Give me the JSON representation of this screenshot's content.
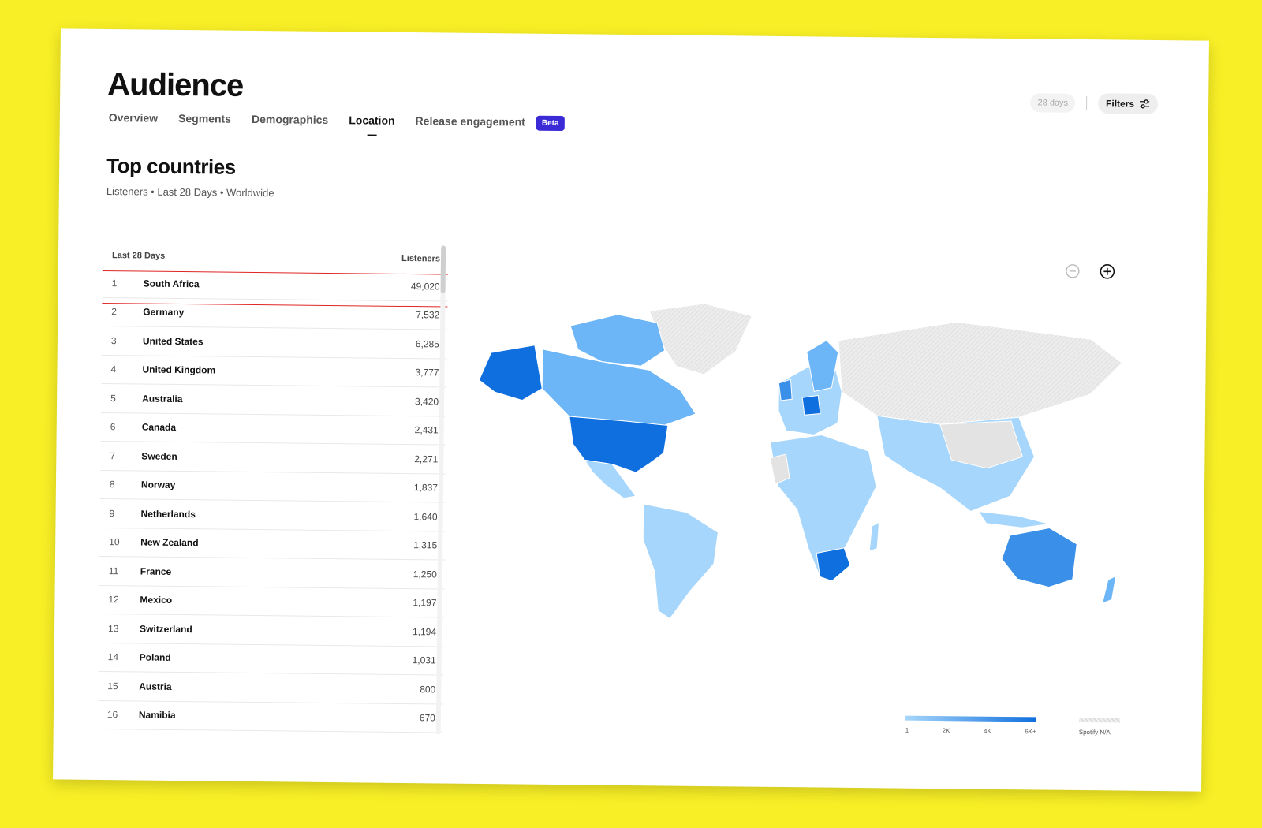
{
  "page": {
    "title": "Audience"
  },
  "tabs": [
    {
      "label": "Overview",
      "active": false
    },
    {
      "label": "Segments",
      "active": false
    },
    {
      "label": "Demographics",
      "active": false
    },
    {
      "label": "Location",
      "active": true
    },
    {
      "label": "Release engagement",
      "active": false
    }
  ],
  "badge": {
    "label": "Beta",
    "color": "#3b2bd6"
  },
  "controls": {
    "days_label": "28 days",
    "filters_label": "Filters",
    "filters_icon": "sliders-icon"
  },
  "section": {
    "title": "Top countries",
    "subtitle": "Listeners • Last 28 Days • Worldwide"
  },
  "table": {
    "header_left": "Last 28 Days",
    "header_right": "Listeners",
    "rows": [
      {
        "rank": "1",
        "country": "South Africa",
        "listeners": "49,020"
      },
      {
        "rank": "2",
        "country": "Germany",
        "listeners": "7,532"
      },
      {
        "rank": "3",
        "country": "United States",
        "listeners": "6,285"
      },
      {
        "rank": "4",
        "country": "United Kingdom",
        "listeners": "3,777"
      },
      {
        "rank": "5",
        "country": "Australia",
        "listeners": "3,420"
      },
      {
        "rank": "6",
        "country": "Canada",
        "listeners": "2,431"
      },
      {
        "rank": "7",
        "country": "Sweden",
        "listeners": "2,271"
      },
      {
        "rank": "8",
        "country": "Norway",
        "listeners": "1,837"
      },
      {
        "rank": "9",
        "country": "Netherlands",
        "listeners": "1,640"
      },
      {
        "rank": "10",
        "country": "New Zealand",
        "listeners": "1,315"
      },
      {
        "rank": "11",
        "country": "France",
        "listeners": "1,250"
      },
      {
        "rank": "12",
        "country": "Mexico",
        "listeners": "1,197"
      },
      {
        "rank": "13",
        "country": "Switzerland",
        "listeners": "1,194"
      },
      {
        "rank": "14",
        "country": "Poland",
        "listeners": "1,031"
      },
      {
        "rank": "15",
        "country": "Austria",
        "listeners": "800"
      },
      {
        "rank": "16",
        "country": "Namibia",
        "listeners": "670"
      }
    ],
    "highlighted_row": "1",
    "highlight_color": "#e02424"
  },
  "map": {
    "zoom_out_icon": "minus-circle-icon",
    "zoom_in_icon": "plus-circle-icon",
    "colors": {
      "darkest": "#0f6fde",
      "dark": "#3a8fe8",
      "medium": "#6cb5f6",
      "light": "#a6d6fb",
      "na": "#e3e3e3"
    }
  },
  "legend": {
    "ticks": [
      "1",
      "2K",
      "4K",
      "6K+"
    ],
    "na_label": "Spotify N/A"
  }
}
